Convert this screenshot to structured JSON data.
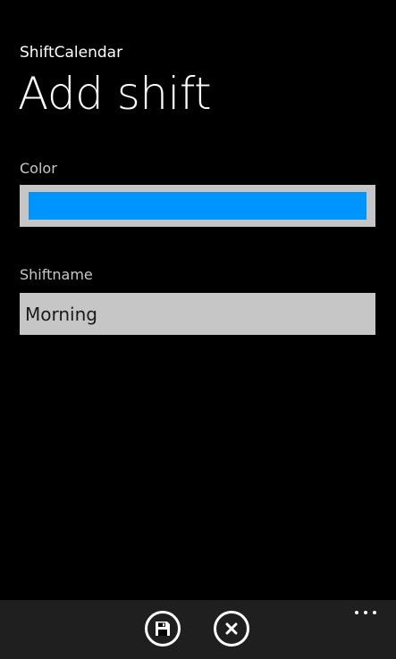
{
  "header": {
    "app_title": "ShiftCalendar",
    "page_title": "Add shift"
  },
  "form": {
    "color": {
      "label": "Color",
      "value": "#0094ff"
    },
    "shiftname": {
      "label": "Shiftname",
      "value": "Morning"
    }
  },
  "app_bar": {
    "buttons": [
      {
        "icon": "save-icon"
      },
      {
        "icon": "cancel-icon"
      }
    ],
    "more_icon": "ellipsis-icon"
  }
}
